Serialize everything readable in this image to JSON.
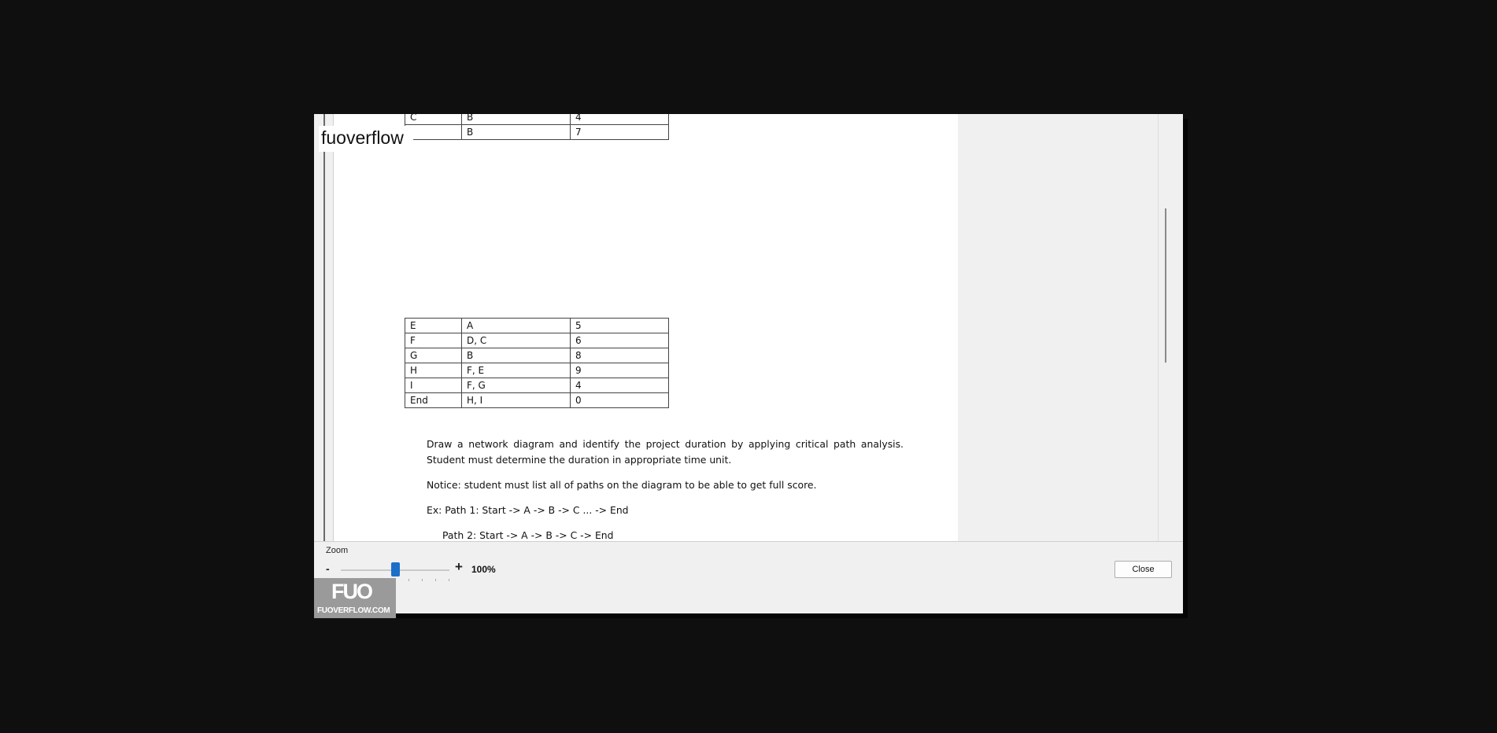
{
  "watermark": {
    "text": "fuoverflow"
  },
  "document": {
    "top_table_rows": [
      [
        "C",
        "B",
        "4"
      ],
      [
        "",
        "B",
        "7"
      ]
    ],
    "table_rows": [
      [
        "E",
        "A",
        "5"
      ],
      [
        "F",
        "D, C",
        "6"
      ],
      [
        "G",
        "B",
        "8"
      ],
      [
        "H",
        "F, E",
        "9"
      ],
      [
        "I",
        "F, G",
        "4"
      ],
      [
        "End",
        "H, I",
        "0"
      ]
    ],
    "instruction": "Draw a network diagram and identify the project duration by applying critical path analysis. Student must determine the duration in appropriate time unit.",
    "notice": "Notice: student must list all of paths on the diagram to be able to get full score.",
    "example_path1": "Ex: Path 1: Start -> A -> B -> C ... -> End",
    "example_path2": "Path 2: Start -> A -> B -> C -> End"
  },
  "zoom": {
    "label": "Zoom",
    "minus": "-",
    "plus": "+",
    "value": "100%",
    "slider_fraction": 0.5
  },
  "buttons": {
    "close": "Close"
  },
  "logo": {
    "main": "FUO",
    "sub": "FUOVERFLOW.COM"
  }
}
